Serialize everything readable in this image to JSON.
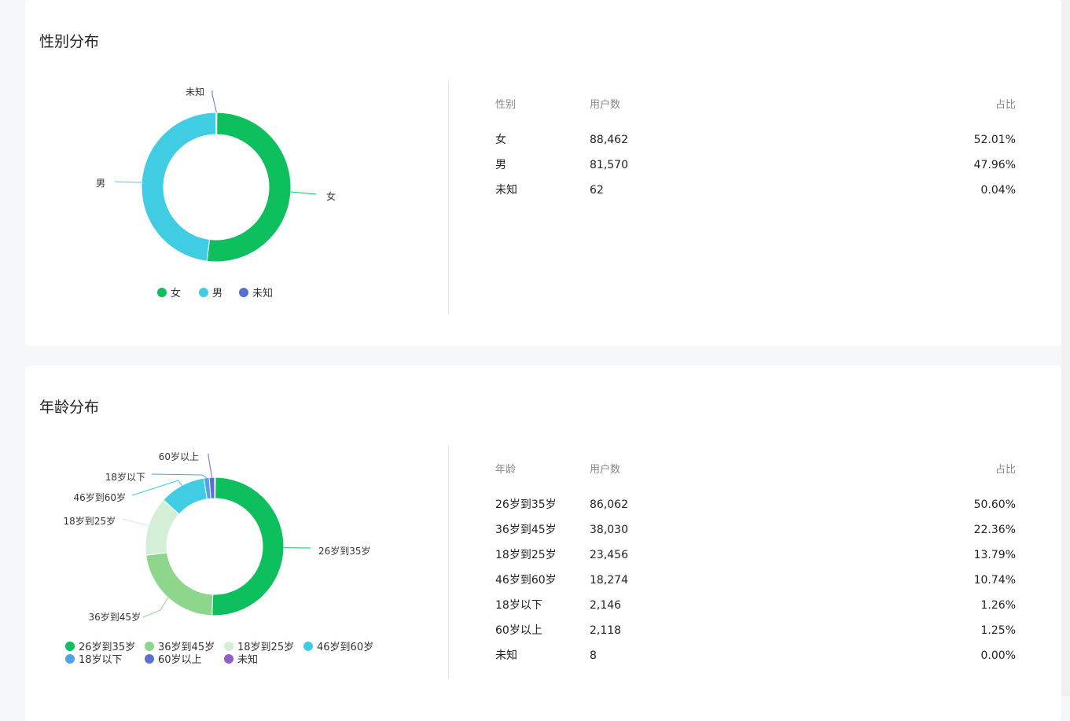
{
  "gender": {
    "title": "性别分布",
    "headers": [
      "性别",
      "用户数",
      "占比"
    ],
    "rows": [
      {
        "label": "女",
        "count": "88,462",
        "pct": "52.01%"
      },
      {
        "label": "男",
        "count": "81,570",
        "pct": "47.96%"
      },
      {
        "label": "未知",
        "count": "62",
        "pct": "0.04%"
      }
    ],
    "legend": [
      "女",
      "男",
      "未知"
    ]
  },
  "age": {
    "title": "年龄分布",
    "headers": [
      "年龄",
      "用户数",
      "占比"
    ],
    "rows": [
      {
        "label": "26岁到35岁",
        "count": "86,062",
        "pct": "50.60%"
      },
      {
        "label": "36岁到45岁",
        "count": "38,030",
        "pct": "22.36%"
      },
      {
        "label": "18岁到25岁",
        "count": "23,456",
        "pct": "13.79%"
      },
      {
        "label": "46岁到60岁",
        "count": "18,274",
        "pct": "10.74%"
      },
      {
        "label": "18岁以下",
        "count": "2,146",
        "pct": "1.26%"
      },
      {
        "label": "60岁以上",
        "count": "2,118",
        "pct": "1.25%"
      },
      {
        "label": "未知",
        "count": "8",
        "pct": "0.00%"
      }
    ],
    "legend": [
      "26岁到35岁",
      "36岁到45岁",
      "18岁到25岁",
      "46岁到60岁",
      "18岁以下",
      "60岁以上",
      "未知"
    ]
  },
  "chart_data": [
    {
      "type": "pie",
      "title": "性别分布",
      "categories": [
        "女",
        "男",
        "未知"
      ],
      "values": [
        88462,
        81570,
        62
      ],
      "colors": [
        "#0dbf5d",
        "#40cde3",
        "#5b6fd1"
      ],
      "legend": "bottom"
    },
    {
      "type": "pie",
      "title": "年龄分布",
      "categories": [
        "26岁到35岁",
        "36岁到45岁",
        "18岁到25岁",
        "46岁到60岁",
        "18岁以下",
        "60岁以上",
        "未知"
      ],
      "values": [
        86062,
        38030,
        23456,
        18274,
        2146,
        2118,
        8
      ],
      "colors": [
        "#0dbf5d",
        "#8dd68b",
        "#d3efd6",
        "#40cde3",
        "#4ba3e8",
        "#5b6fd1",
        "#8d5ec9"
      ],
      "legend": "bottom"
    }
  ]
}
